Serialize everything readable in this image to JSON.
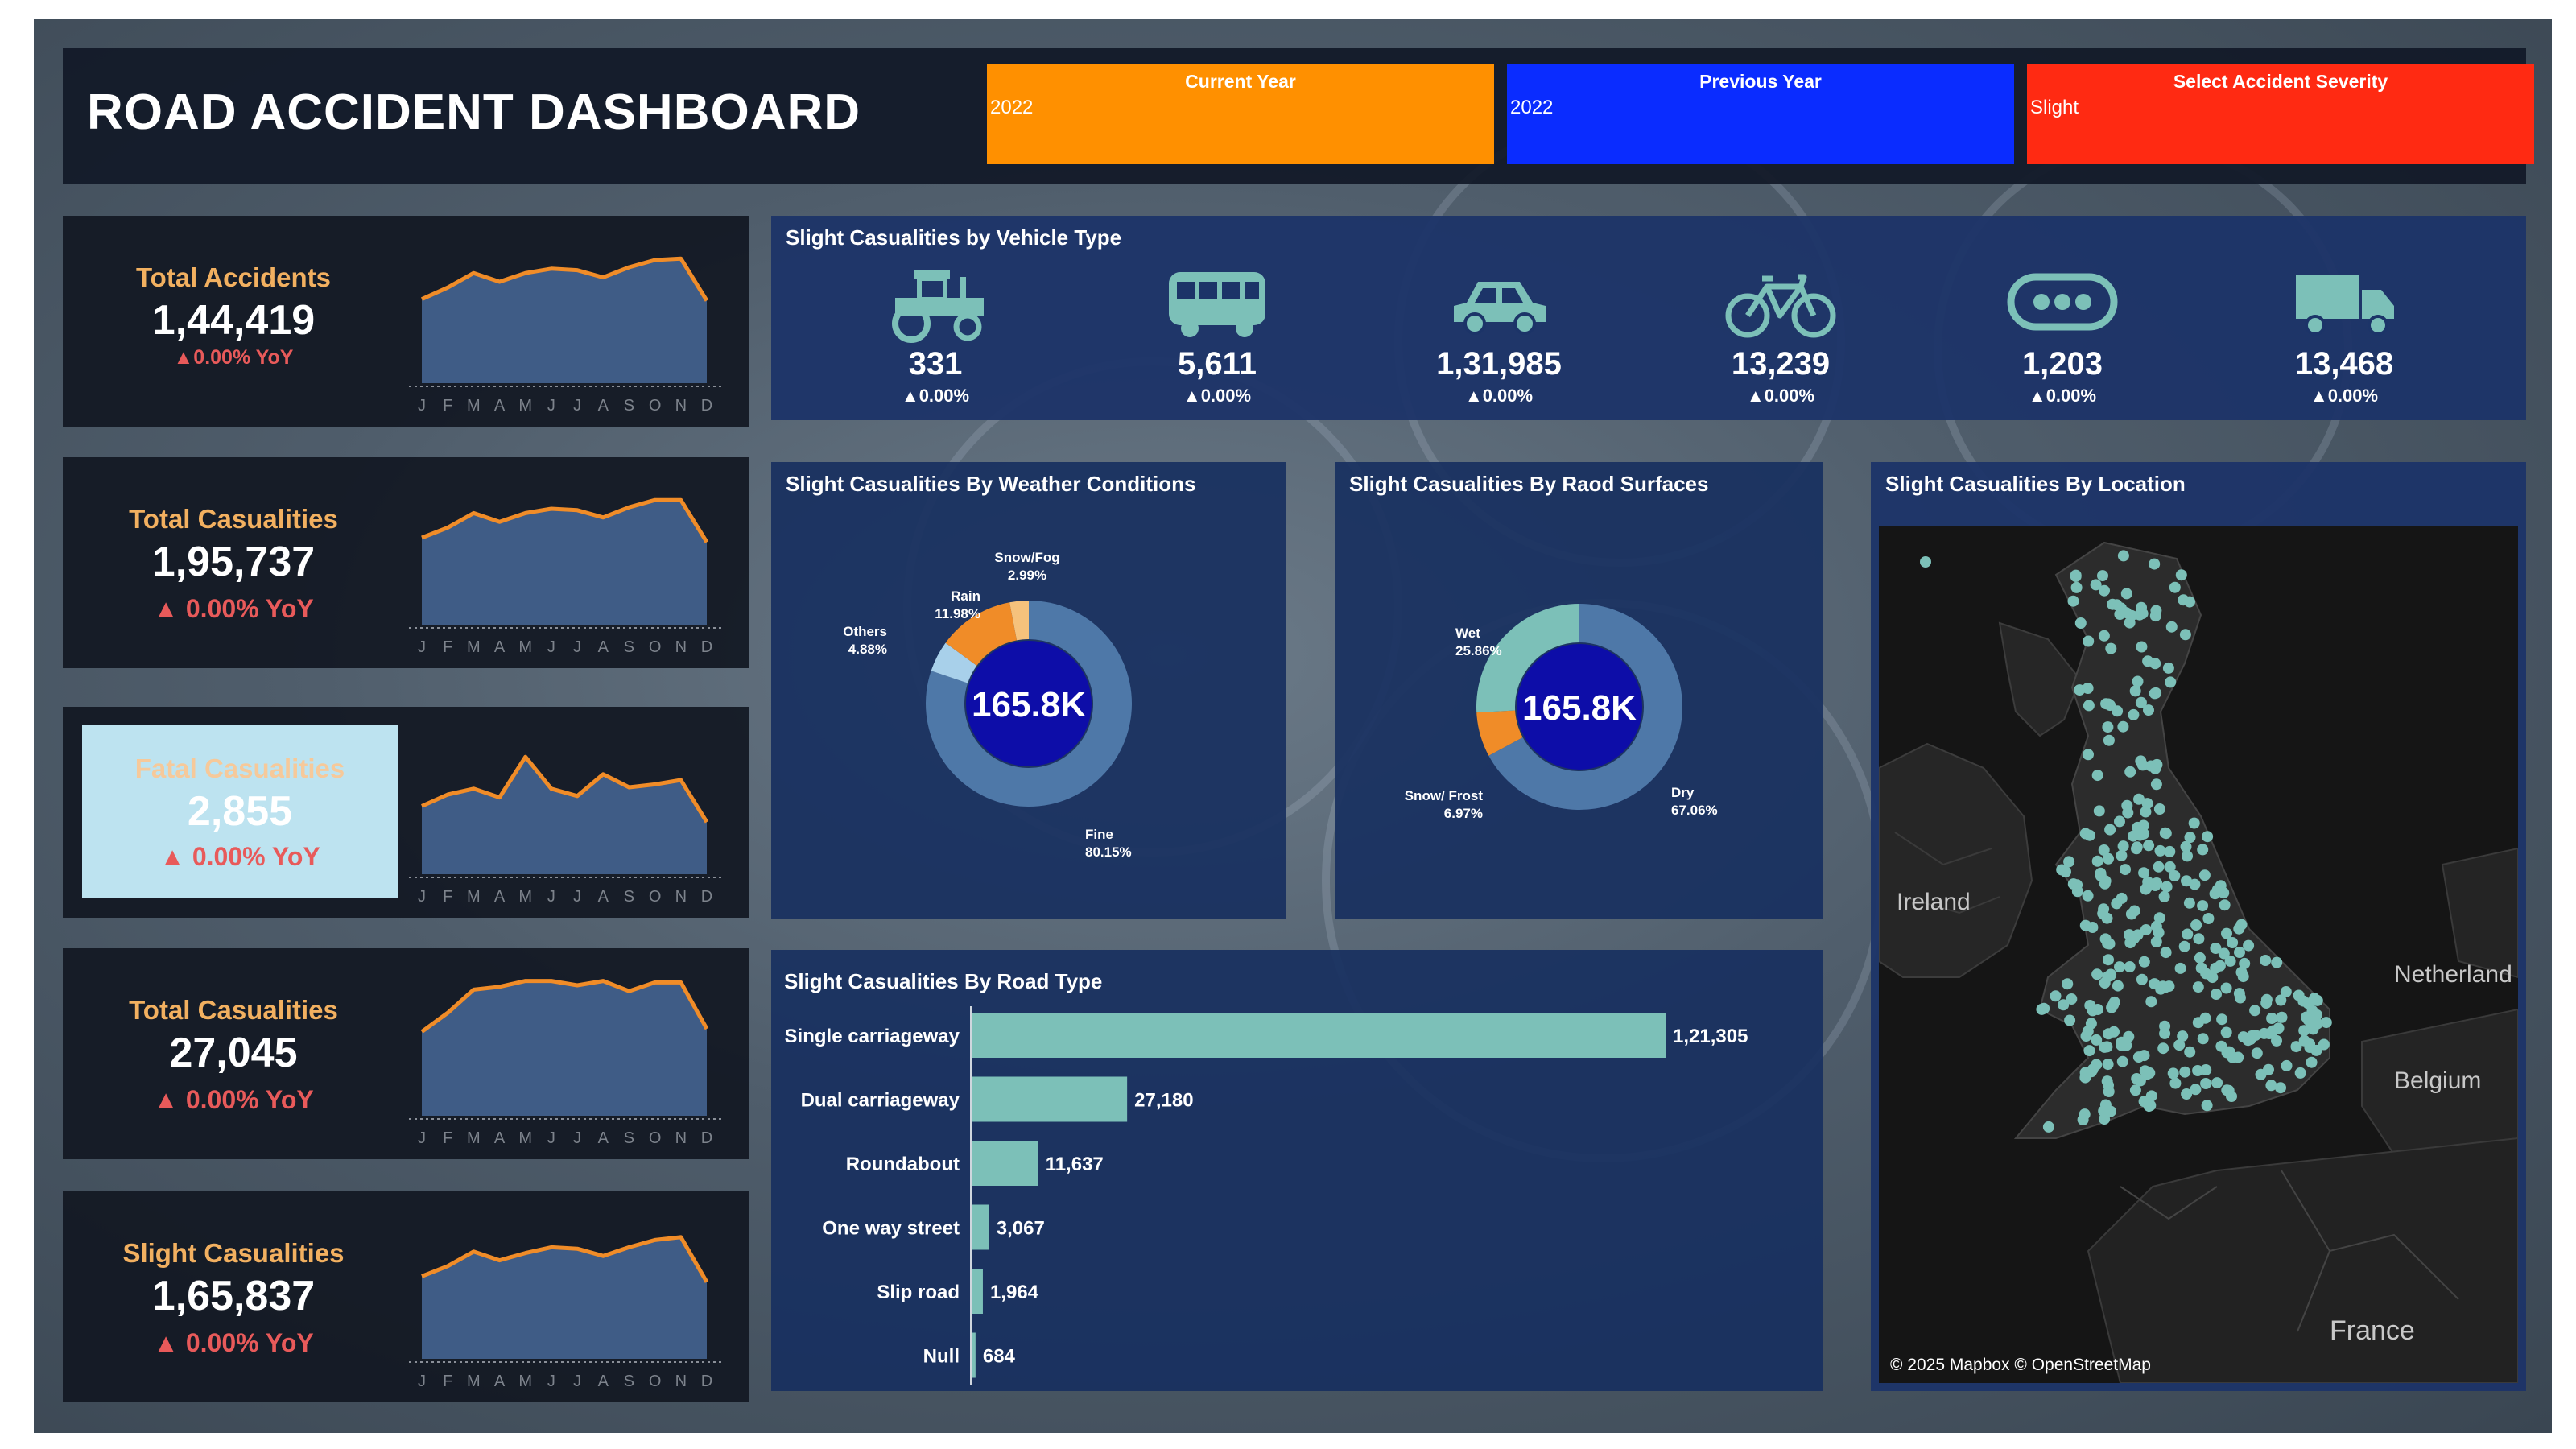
{
  "header": {
    "title": "ROAD ACCIDENT DASHBOARD",
    "filters": [
      {
        "label": "Current Year",
        "value": "2022",
        "color": "#ff9000"
      },
      {
        "label": "Previous Year",
        "value": "2022",
        "color": "#0a2cff"
      },
      {
        "label": "Select Accident Severity",
        "value": "Slight",
        "color": "#ff2a12"
      }
    ]
  },
  "kpis": [
    {
      "label": "Total Accidents",
      "value": "1,44,419",
      "yoy": "▲0.00% YoY"
    },
    {
      "label": "Total Casualities",
      "value": "1,95,737",
      "yoy": "▲ 0.00% YoY"
    },
    {
      "label": "Fatal Casualities",
      "value": "2,855",
      "yoy": "▲ 0.00% YoY"
    },
    {
      "label": "Total Casualities",
      "value": "27,045",
      "yoy": "▲ 0.00% YoY"
    },
    {
      "label": "Slight Casualities",
      "value": "1,65,837",
      "yoy": "▲ 0.00% YoY"
    }
  ],
  "vehicles": {
    "title": "Slight Casualities by Vehicle Type",
    "items": [
      {
        "icon": "tractor-icon",
        "value": "331",
        "yoy": "▲0.00%"
      },
      {
        "icon": "bus-icon",
        "value": "5,611",
        "yoy": "▲0.00%"
      },
      {
        "icon": "car-icon",
        "value": "1,31,985",
        "yoy": "▲0.00%"
      },
      {
        "icon": "bicycle-icon",
        "value": "13,239",
        "yoy": "▲0.00%"
      },
      {
        "icon": "more-icon",
        "value": "1,203",
        "yoy": "▲0.00%"
      },
      {
        "icon": "truck-icon",
        "value": "13,468",
        "yoy": "▲0.00%"
      }
    ]
  },
  "weather": {
    "title": "Slight Casualities By Weather Conditions",
    "center": "165.8K"
  },
  "surface": {
    "title": "Slight Casualities By Raod Surfaces",
    "center": "165.8K"
  },
  "location": {
    "title": "Slight Casualities By Location",
    "labels": {
      "ireland": "Ireland",
      "netherlands": "Netherland",
      "belgium": "Belgium",
      "france": "France"
    },
    "attribution": "© 2025 Mapbox © OpenStreetMap"
  },
  "roadtype": {
    "title": "Slight Casualities By Road Type"
  },
  "colors": {
    "teal": "#7cc0b8",
    "orange": "#f08c28",
    "donut_blue": "#4e78a8",
    "donut_center": "#0d0da8",
    "light_blue": "#a8d0ea",
    "peach": "#f6c27c"
  },
  "chart_data": [
    {
      "type": "area",
      "id": "kpi-accidents",
      "x": [
        "J",
        "F",
        "M",
        "A",
        "M",
        "J",
        "J",
        "A",
        "S",
        "O",
        "N",
        "D"
      ],
      "values": [
        0.58,
        0.66,
        0.76,
        0.7,
        0.76,
        0.79,
        0.78,
        0.73,
        0.8,
        0.85,
        0.86,
        0.57
      ],
      "ylim": [
        0,
        1
      ],
      "grid": false
    },
    {
      "type": "area",
      "id": "kpi-total-casualities",
      "x": [
        "J",
        "F",
        "M",
        "A",
        "M",
        "J",
        "J",
        "A",
        "S",
        "O",
        "N",
        "D"
      ],
      "values": [
        0.6,
        0.67,
        0.77,
        0.71,
        0.77,
        0.8,
        0.79,
        0.74,
        0.81,
        0.86,
        0.86,
        0.57
      ],
      "ylim": [
        0,
        1
      ],
      "grid": false
    },
    {
      "type": "area",
      "id": "kpi-fatal",
      "x": [
        "J",
        "F",
        "M",
        "A",
        "M",
        "J",
        "J",
        "A",
        "S",
        "O",
        "N",
        "D"
      ],
      "values": [
        0.47,
        0.55,
        0.59,
        0.53,
        0.81,
        0.59,
        0.54,
        0.69,
        0.6,
        0.62,
        0.65,
        0.36
      ],
      "ylim": [
        0,
        1
      ],
      "grid": false
    },
    {
      "type": "area",
      "id": "kpi-total-casualities-2",
      "x": [
        "J",
        "F",
        "M",
        "A",
        "M",
        "J",
        "J",
        "A",
        "S",
        "O",
        "N",
        "D"
      ],
      "values": [
        0.58,
        0.71,
        0.87,
        0.89,
        0.93,
        0.93,
        0.9,
        0.93,
        0.86,
        0.92,
        0.92,
        0.6
      ],
      "ylim": [
        0,
        1
      ],
      "grid": false
    },
    {
      "type": "area",
      "id": "kpi-slight",
      "x": [
        "J",
        "F",
        "M",
        "A",
        "M",
        "J",
        "J",
        "A",
        "S",
        "O",
        "N",
        "D"
      ],
      "values": [
        0.57,
        0.64,
        0.74,
        0.68,
        0.73,
        0.77,
        0.76,
        0.71,
        0.77,
        0.82,
        0.84,
        0.53
      ],
      "ylim": [
        0,
        1
      ],
      "grid": false
    },
    {
      "type": "pie",
      "id": "weather-donut",
      "title": "Slight Casualities By Weather Conditions",
      "slices": [
        {
          "name": "Fine",
          "value": 80.15,
          "label": "80.15%",
          "color": "#4e78a8"
        },
        {
          "name": "Others",
          "value": 4.88,
          "label": "4.88%",
          "color": "#a8d0ea"
        },
        {
          "name": "Rain",
          "value": 11.98,
          "label": "11.98%",
          "color": "#f08c28"
        },
        {
          "name": "Snow/Fog",
          "value": 2.99,
          "label": "2.99%",
          "color": "#f6c27c"
        }
      ]
    },
    {
      "type": "pie",
      "id": "surface-donut",
      "title": "Slight Casualities By Raod Surfaces",
      "slices": [
        {
          "name": "Dry",
          "value": 67.06,
          "label": "67.06%",
          "color": "#4e78a8"
        },
        {
          "name": "Snow/ Frost",
          "value": 6.97,
          "label": "6.97%",
          "color": "#f08c28"
        },
        {
          "name": "Wet",
          "value": 25.86,
          "label": "25.86%",
          "color": "#7cc0b8"
        }
      ]
    },
    {
      "type": "bar",
      "id": "road-type",
      "title": "Slight Casualities By Road Type",
      "categories": [
        "Single carriageway",
        "Dual carriageway",
        "Roundabout",
        "One way street",
        "Slip road",
        "Null"
      ],
      "values": [
        121305,
        27180,
        11637,
        3067,
        1964,
        684
      ],
      "value_labels": [
        "1,21,305",
        "27,180",
        "11,637",
        "3,067",
        "1,964",
        "684"
      ],
      "orientation": "horizontal"
    }
  ]
}
